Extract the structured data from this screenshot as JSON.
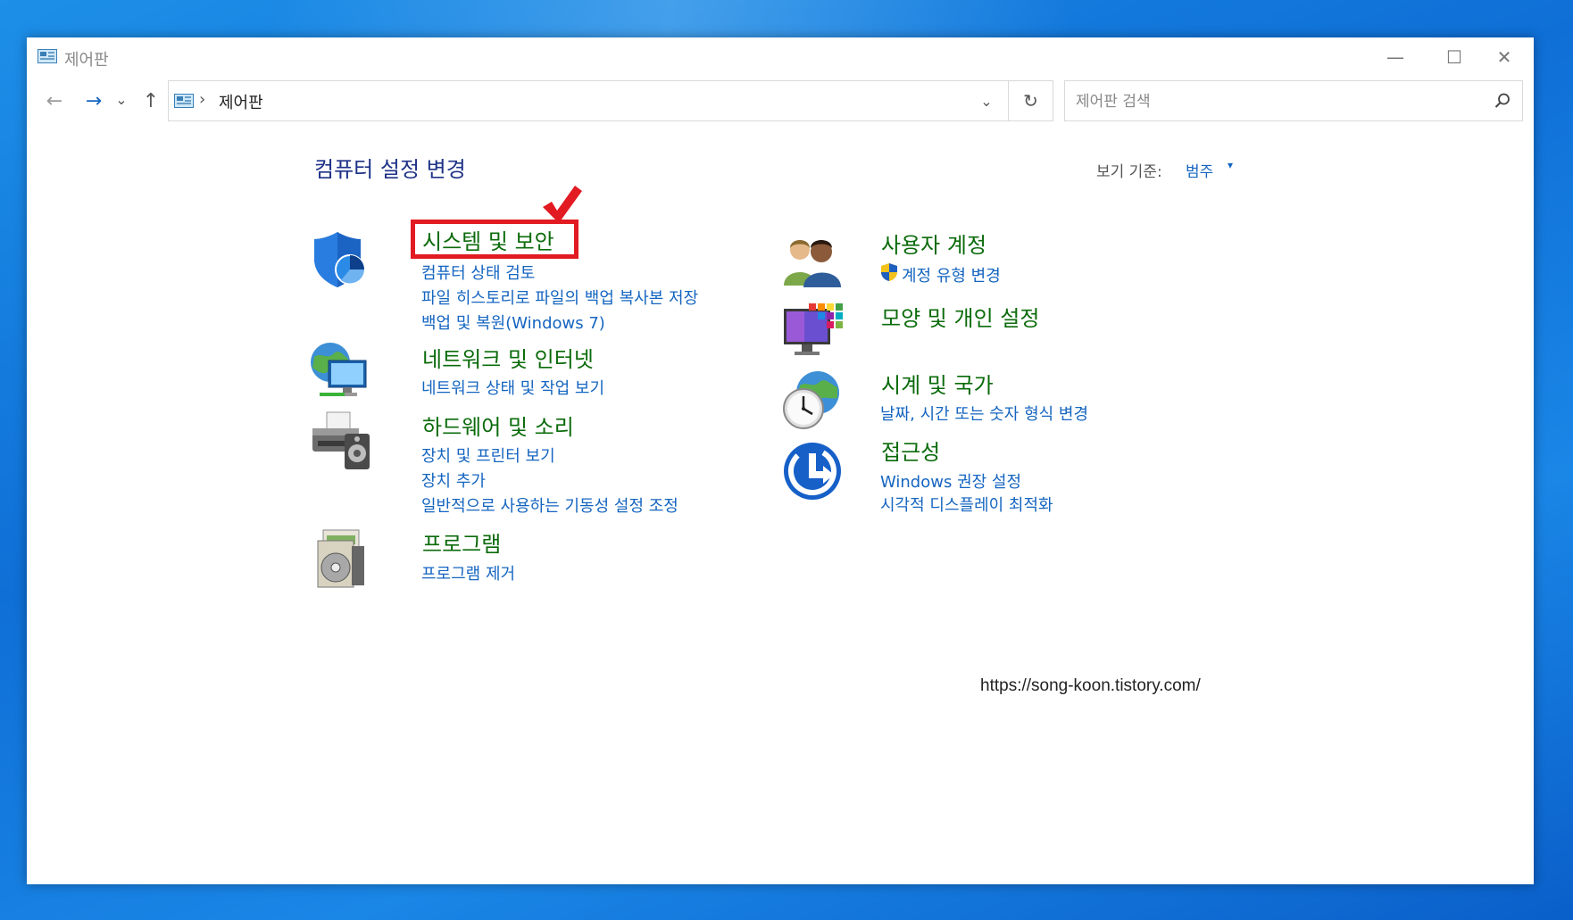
{
  "window": {
    "title": "제어판",
    "minimize_glyph": "—",
    "maximize_glyph": "☐",
    "close_glyph": "✕"
  },
  "nav": {
    "back_glyph": "←",
    "forward_glyph": "→",
    "recent_glyph": "⌄",
    "up_glyph": "↑",
    "address_separator": "›",
    "address_text": "제어판",
    "dropdown_glyph": "⌄",
    "refresh_glyph": "↻",
    "search_placeholder": "제어판 검색"
  },
  "main": {
    "heading": "컴퓨터 설정 변경",
    "view_by_label": "보기 기준:",
    "view_by_value": "범주",
    "view_by_caret": "▾"
  },
  "categories": [
    {
      "title": "시스템 및 보안",
      "icon": "shield-icon",
      "links": [
        "컴퓨터 상태 검토",
        "파일 히스토리로 파일의 백업 복사본 저장",
        "백업 및 복원(Windows 7)"
      ]
    },
    {
      "title": "네트워크 및 인터넷",
      "icon": "network-globe-icon",
      "links": [
        "네트워크 상태 및 작업 보기"
      ]
    },
    {
      "title": "하드웨어 및 소리",
      "icon": "printer-speaker-icon",
      "links": [
        "장치 및 프린터 보기",
        "장치 추가",
        "일반적으로 사용하는 기동성 설정 조정"
      ]
    },
    {
      "title": "프로그램",
      "icon": "programs-disc-icon",
      "links": [
        "프로그램 제거"
      ]
    },
    {
      "title": "사용자 계정",
      "icon": "users-icon",
      "links": [
        "계정 유형 변경"
      ]
    },
    {
      "title": "모양 및 개인 설정",
      "icon": "monitor-palette-icon",
      "links": []
    },
    {
      "title": "시계 및 국가",
      "icon": "clock-globe-icon",
      "links": [
        "날짜, 시간 또는 숫자 형식 변경"
      ]
    },
    {
      "title": "접근성",
      "icon": "accessibility-icon",
      "links": [
        "Windows 권장 설정",
        "시각적 디스플레이 최적화"
      ]
    }
  ],
  "watermark": "https://song-koon.tistory.com/",
  "colors": {
    "category_title": "#0b6b0b",
    "link": "#1565c0",
    "heading": "#1e3287",
    "highlight_box": "#e21b22"
  }
}
